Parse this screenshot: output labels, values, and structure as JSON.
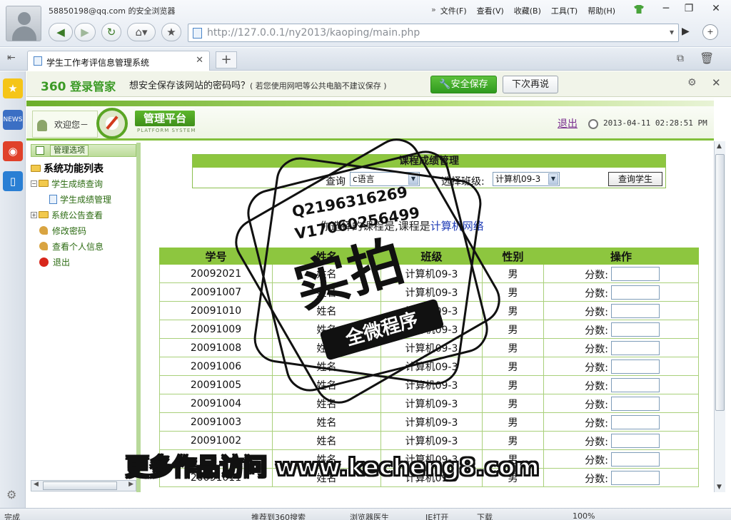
{
  "browser": {
    "account": "58850198@qq.com 的安全浏览器",
    "menu": [
      "文件(F)",
      "查看(V)",
      "收藏(B)",
      "工具(T)",
      "帮助(H)"
    ],
    "url": "http://127.0.0.1/ny2013/kaoping/main.php",
    "tab_title": "学生工作考评信息管理系统"
  },
  "password_bar": {
    "brand_num": "360",
    "brand_text": "登录管家",
    "message": "想安全保存该网站的密码吗？",
    "note": "( 若您使用网吧等公共电脑不建议保存 )",
    "save_label": "安全保存",
    "later_label": "下次再说"
  },
  "header": {
    "welcome": "欢迎您－",
    "logo_title": "管理平台",
    "logo_sub": "PLATFORM SYSTEM",
    "logout": "退出",
    "datetime": "2013-04-11 02:28:51 PM"
  },
  "sidebar": {
    "options_label": "管理选项",
    "root": "系统功能列表",
    "items": [
      {
        "label": "学生成绩查询",
        "type": "folder",
        "expander": "−"
      },
      {
        "label": "学生成绩管理",
        "type": "doc"
      },
      {
        "label": "系统公告查看",
        "type": "folder",
        "expander": "+"
      },
      {
        "label": "修改密码",
        "type": "key"
      },
      {
        "label": "查看个人信息",
        "type": "key"
      },
      {
        "label": "退出",
        "type": "exit"
      }
    ]
  },
  "filter": {
    "title": "课程成绩管理",
    "query_label": "查询",
    "course_value": "c语言",
    "class_label": "选择班级:",
    "class_value": "计算机09-3",
    "query_button": "查询学生"
  },
  "info": {
    "prefix": "你选择的课程是,课程是",
    "course": "计算机网络"
  },
  "table": {
    "headers": [
      "学号",
      "姓名",
      "班级",
      "性别",
      "操作"
    ],
    "score_label": "分数:",
    "rows": [
      {
        "id": "20092021",
        "name": "姓名",
        "class": "计算机09-3",
        "gender": "男"
      },
      {
        "id": "20091007",
        "name": "姓名",
        "class": "计算机09-3",
        "gender": "男"
      },
      {
        "id": "20091010",
        "name": "姓名",
        "class": "计算机09-3",
        "gender": "男"
      },
      {
        "id": "20091009",
        "name": "姓名",
        "class": "计算机09-3",
        "gender": "男"
      },
      {
        "id": "20091008",
        "name": "姓名",
        "class": "计算机09-3",
        "gender": "男"
      },
      {
        "id": "20091006",
        "name": "姓名",
        "class": "计算机09-3",
        "gender": "男"
      },
      {
        "id": "20091005",
        "name": "姓名",
        "class": "计算机09-3",
        "gender": "男"
      },
      {
        "id": "20091004",
        "name": "姓名",
        "class": "计算机09-3",
        "gender": "男"
      },
      {
        "id": "20091003",
        "name": "姓名",
        "class": "计算机09-3",
        "gender": "男"
      },
      {
        "id": "20091002",
        "name": "姓名",
        "class": "计算机09-3",
        "gender": "男"
      },
      {
        "id": "",
        "name": "姓名",
        "class": "计算机09-3",
        "gender": "男"
      },
      {
        "id": "20091011",
        "name": "姓名",
        "class": "计算机09-3",
        "gender": "男"
      }
    ]
  },
  "statusbar": {
    "left": "完成",
    "items": [
      "推荐到360搜索",
      "浏览器医生",
      "IE打开",
      "下载",
      "100%"
    ]
  },
  "watermark": {
    "line1": "Q2196316269",
    "line2": "V17060256499",
    "big": "实拍",
    "band": "全微程序",
    "site": "更多作品访问 www.kecheng8.com"
  }
}
